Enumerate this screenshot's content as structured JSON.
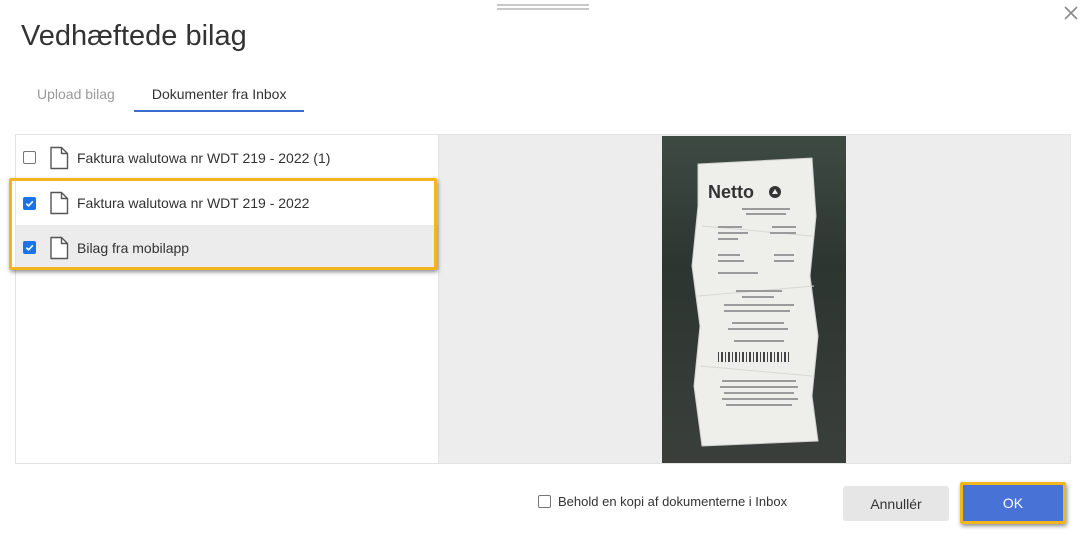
{
  "dialog": {
    "title": "Vedhæftede bilag"
  },
  "tabs": [
    {
      "label": "Upload bilag",
      "active": false
    },
    {
      "label": "Dokumenter fra Inbox",
      "active": true
    }
  ],
  "files": [
    {
      "name": "Faktura walutowa nr WDT 219 - 2022 (1)",
      "checked": false
    },
    {
      "name": "Faktura walutowa nr WDT 219 - 2022",
      "checked": true
    },
    {
      "name": "Bilag fra mobilapp",
      "checked": true
    }
  ],
  "preview": {
    "store_logo": "Netto"
  },
  "footer": {
    "keep_copy_label": "Behold en kopi af dokumenterne i Inbox",
    "keep_copy_checked": false,
    "cancel_label": "Annullér",
    "ok_label": "OK"
  },
  "colors": {
    "accent": "#4872d6",
    "highlight": "#f2b51d",
    "checkbox_checked": "#1a73e8"
  }
}
